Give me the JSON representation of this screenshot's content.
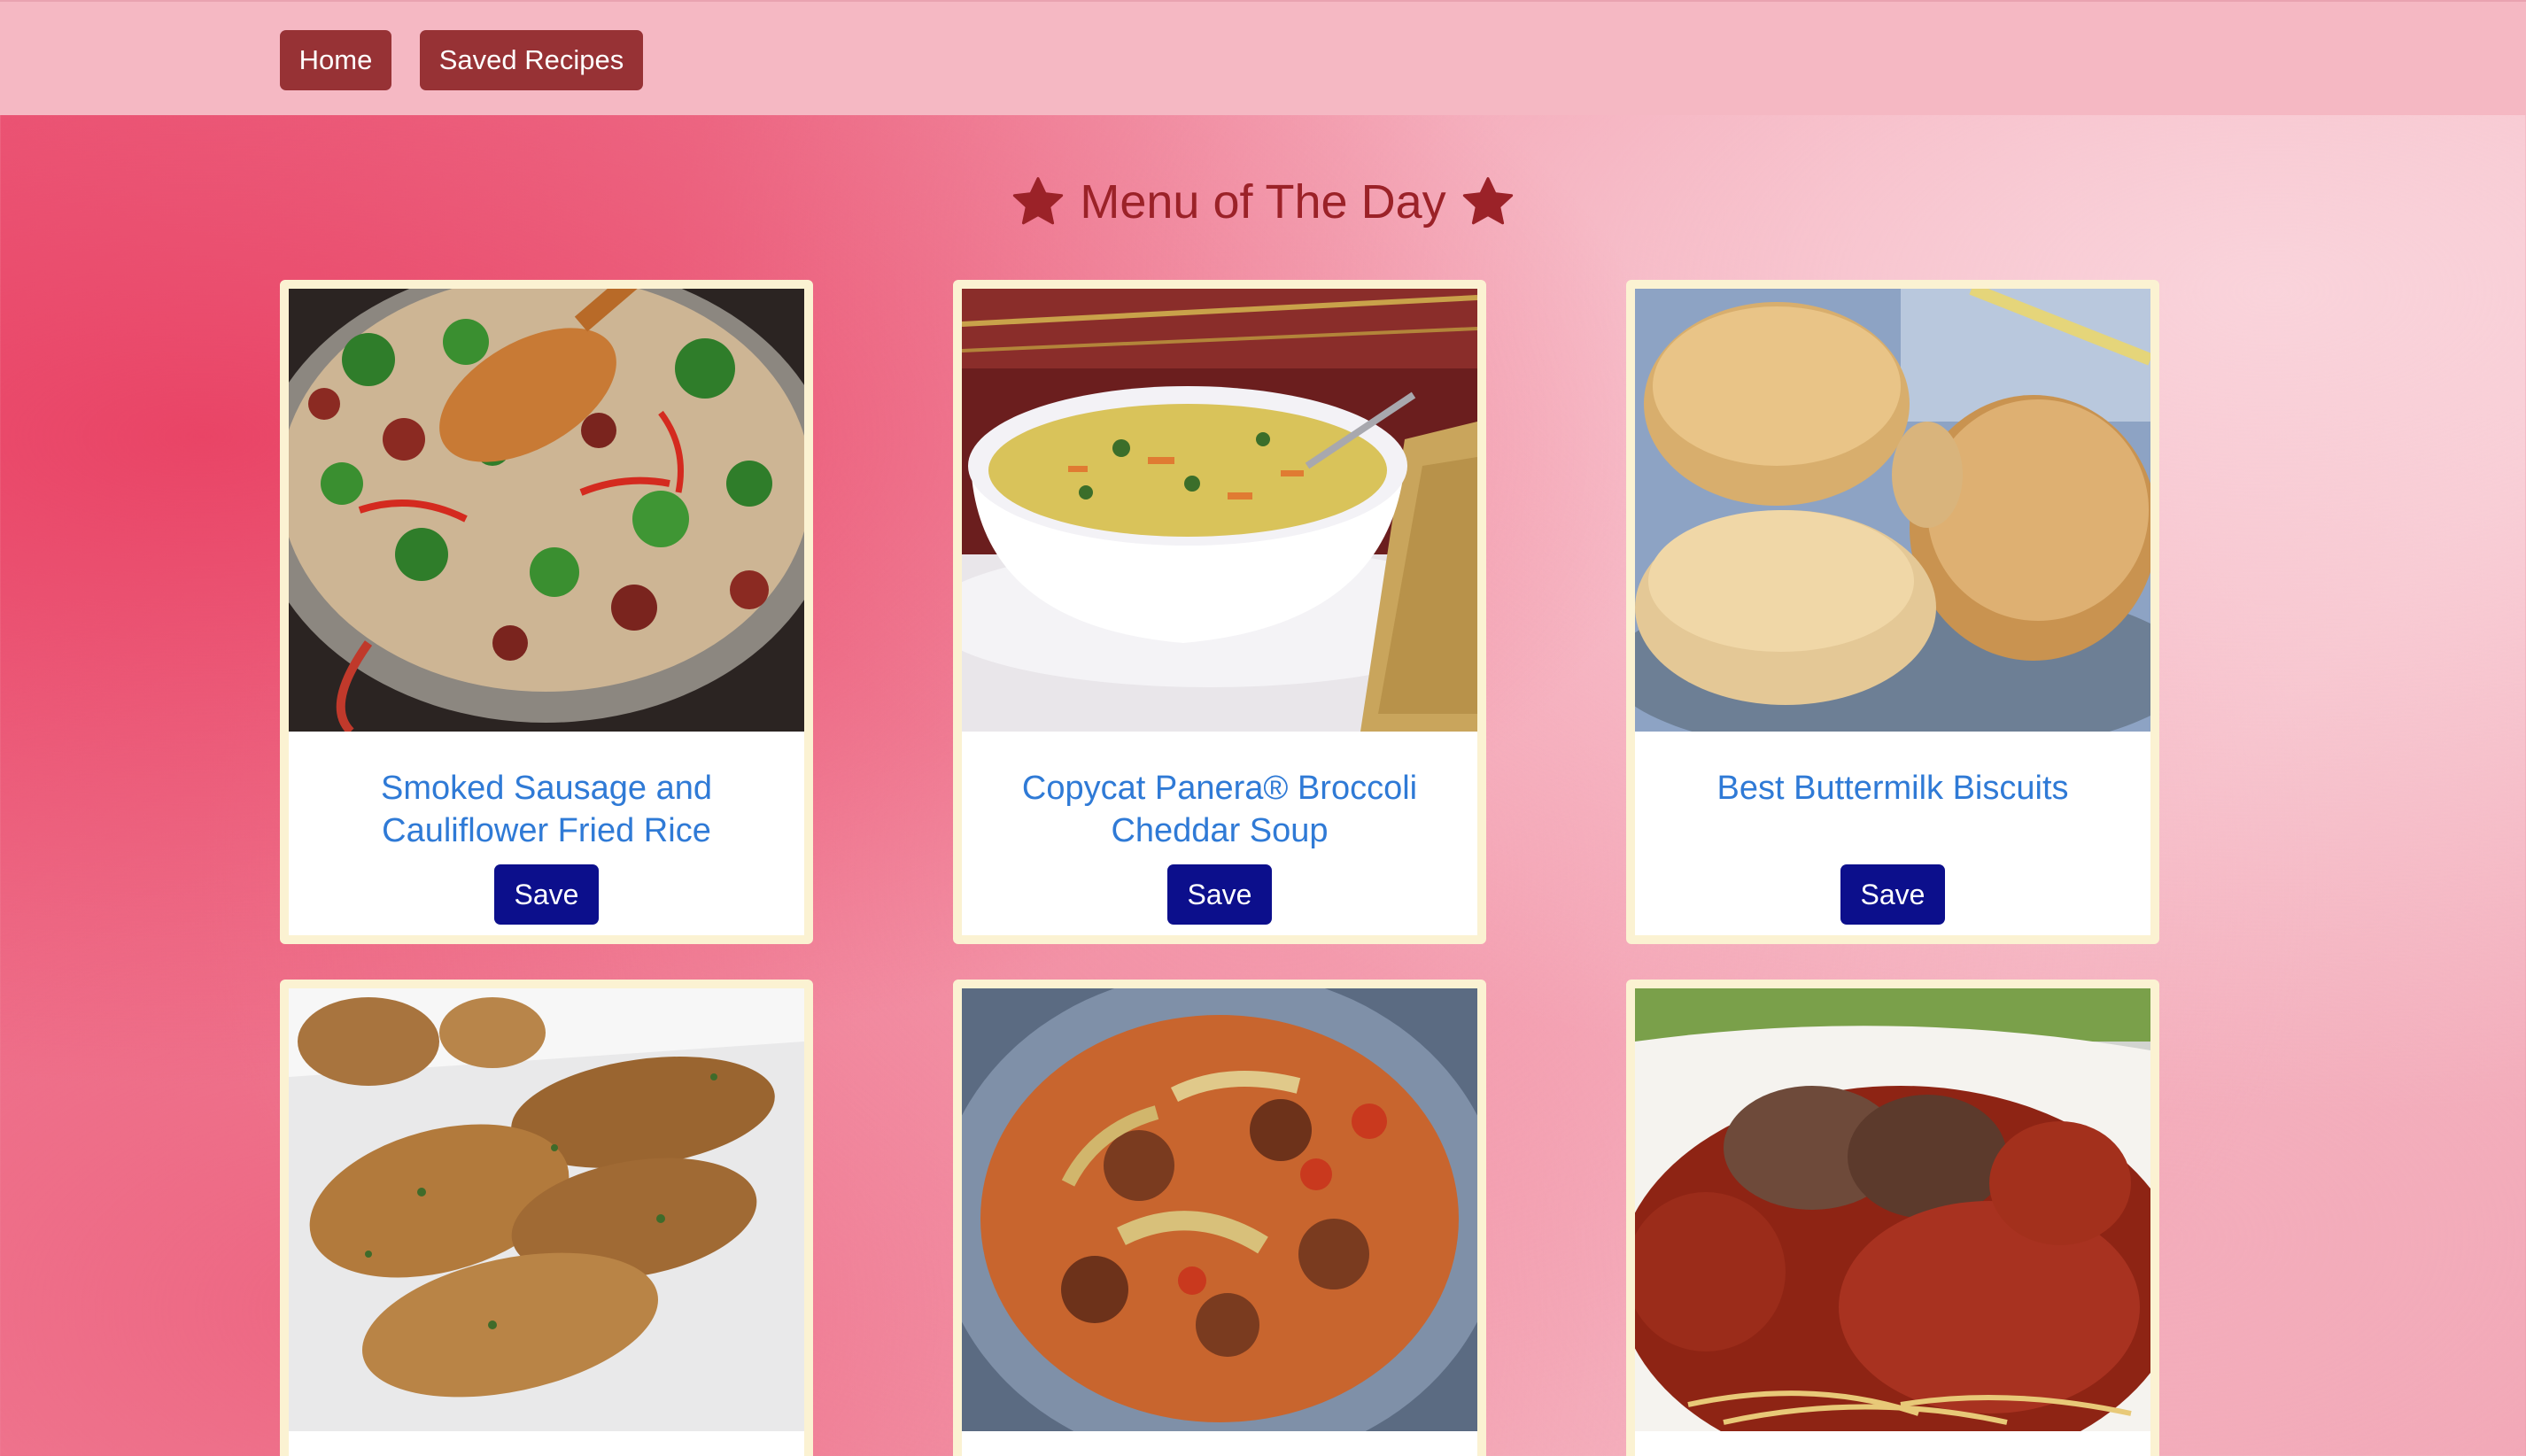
{
  "nav": {
    "home_label": "Home",
    "saved_label": "Saved Recipes"
  },
  "heading": {
    "title": "Menu of The Day",
    "icon": "star-icon",
    "color": "#9b2228"
  },
  "recipes": [
    {
      "title": "Smoked Sausage and Cauliflower Fried Rice",
      "save_label": "Save",
      "image": "sausage-cauliflower-fried-rice-photo"
    },
    {
      "title": "Copycat Panera® Broccoli Cheddar Soup",
      "save_label": "Save",
      "image": "broccoli-cheddar-soup-photo"
    },
    {
      "title": "Best Buttermilk Biscuits",
      "save_label": "Save",
      "image": "buttermilk-biscuits-photo"
    },
    {
      "title": "",
      "save_label": "",
      "image": "fried-chicken-wings-photo"
    },
    {
      "title": "",
      "save_label": "",
      "image": "cabbage-beef-casserole-photo"
    },
    {
      "title": "",
      "save_label": "",
      "image": "spaghetti-meatballs-photo"
    }
  ],
  "colors": {
    "nav_background": "#f5b8c3",
    "nav_button": "#973235",
    "recipe_title": "#2f7ad6",
    "save_button": "#0c0f8c",
    "card_border": "#fbf2d2"
  }
}
